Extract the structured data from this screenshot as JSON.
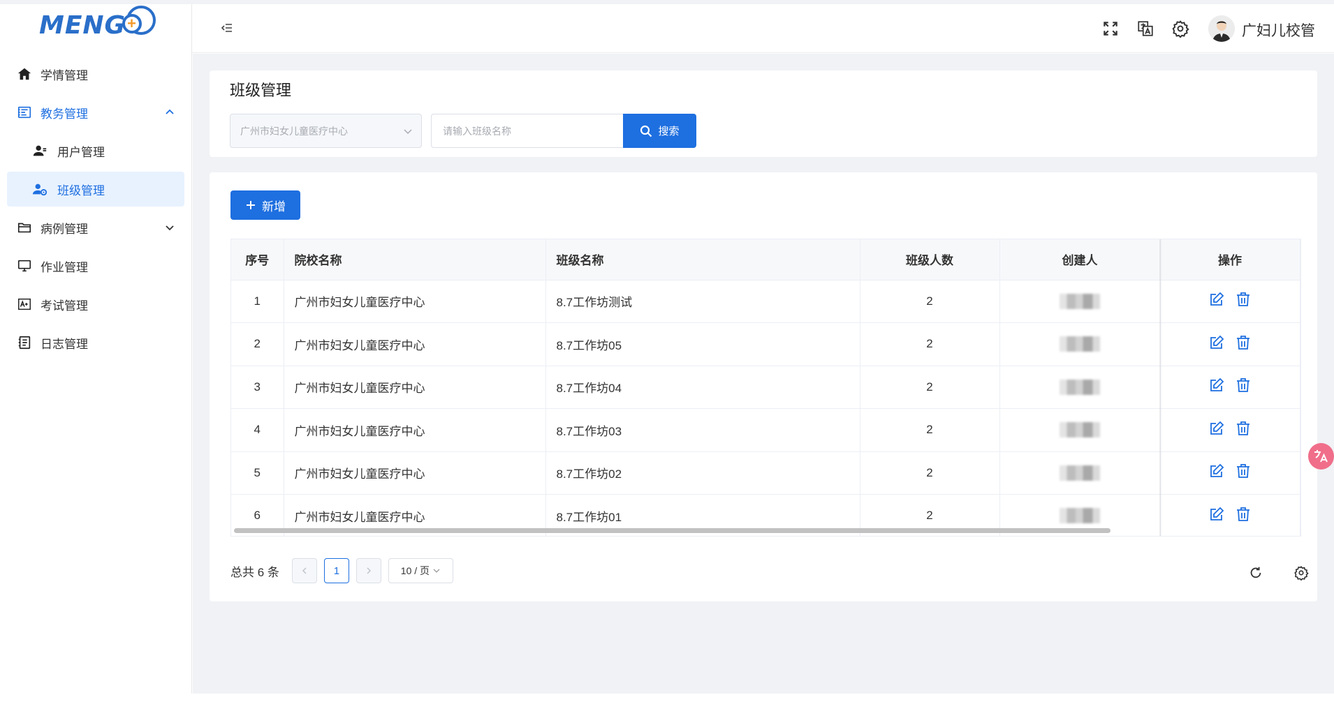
{
  "app": {
    "logo_text": "MENG"
  },
  "sidebar": {
    "items": [
      {
        "label": "学情管理",
        "icon": "home-icon"
      },
      {
        "label": "教务管理",
        "icon": "academic-affairs-icon",
        "expanded": true
      },
      {
        "label": "用户管理",
        "icon": "user-icon",
        "sub": true
      },
      {
        "label": "班级管理",
        "icon": "class-user-icon",
        "sub": true,
        "active": true
      },
      {
        "label": "病例管理",
        "icon": "folder-icon",
        "expanded": false
      },
      {
        "label": "作业管理",
        "icon": "monitor-icon"
      },
      {
        "label": "考试管理",
        "icon": "exam-icon"
      },
      {
        "label": "日志管理",
        "icon": "log-icon"
      }
    ]
  },
  "header": {
    "icons": [
      "fullscreen-icon",
      "translate-icon",
      "settings-icon"
    ],
    "username": "广妇儿校管"
  },
  "search": {
    "title": "班级管理",
    "school_select": "广州市妇女儿童医疗中心",
    "class_input_placeholder": "请输入班级名称",
    "class_input_value": "",
    "search_label": "搜索"
  },
  "toolbar": {
    "add_label": "新增"
  },
  "table": {
    "columns": [
      "序号",
      "院校名称",
      "班级名称",
      "班级人数",
      "创建人",
      "操作"
    ],
    "rows": [
      {
        "index": "1",
        "school": "广州市妇女儿童医疗中心",
        "class_name": "8.7工作坊测试",
        "count": "2"
      },
      {
        "index": "2",
        "school": "广州市妇女儿童医疗中心",
        "class_name": "8.7工作坊05",
        "count": "2"
      },
      {
        "index": "3",
        "school": "广州市妇女儿童医疗中心",
        "class_name": "8.7工作坊04",
        "count": "2"
      },
      {
        "index": "4",
        "school": "广州市妇女儿童医疗中心",
        "class_name": "8.7工作坊03",
        "count": "2"
      },
      {
        "index": "5",
        "school": "广州市妇女儿童医疗中心",
        "class_name": "8.7工作坊02",
        "count": "2"
      },
      {
        "index": "6",
        "school": "广州市妇女儿童医疗中心",
        "class_name": "8.7工作坊01",
        "count": "2"
      }
    ]
  },
  "pagination": {
    "total_text": "总共 6 条",
    "current_page": "1",
    "page_size": "10 / 页"
  },
  "colors": {
    "primary": "#1e6fe0",
    "active_bg": "#e8f2ff",
    "content_bg": "#f0f2f5"
  }
}
